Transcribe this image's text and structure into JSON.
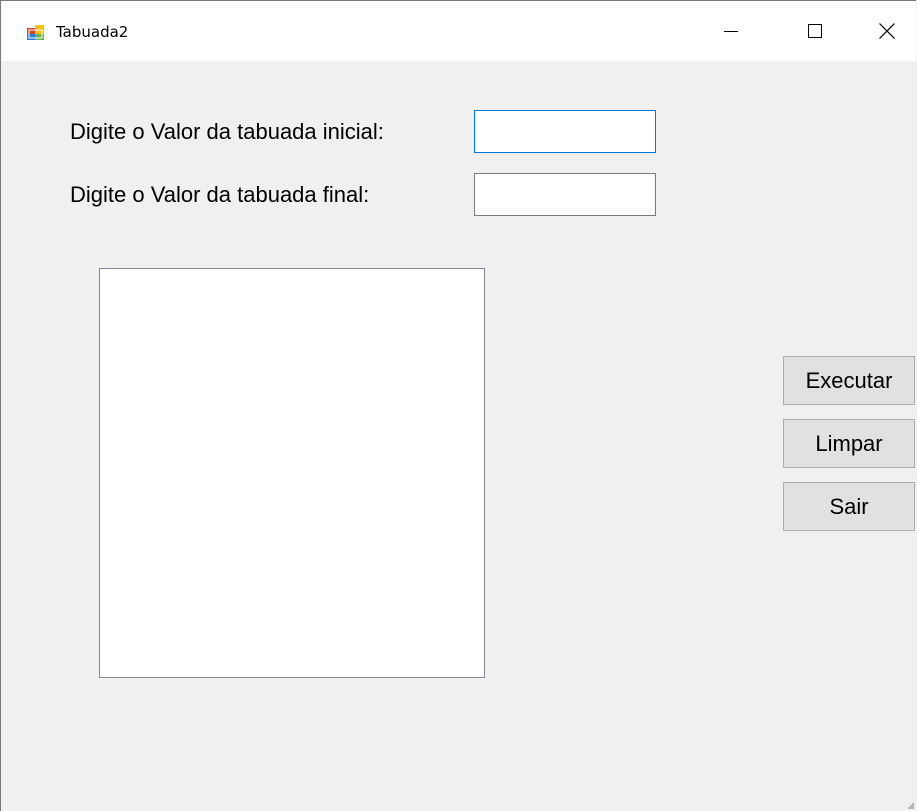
{
  "window": {
    "title": "Tabuada2",
    "controls": {
      "minimize": "minimize-icon",
      "maximize": "maximize-icon",
      "close": "close-icon"
    }
  },
  "form": {
    "label_initial": "Digite o Valor da tabuada inicial:",
    "label_final": "Digite o Valor da tabuada final:",
    "input_initial_value": "",
    "input_final_value": "",
    "list_items": []
  },
  "buttons": {
    "executar": "Executar",
    "limpar": "Limpar",
    "sair": "Sair"
  },
  "colors": {
    "focus_border": "#0078d7",
    "button_face": "#e1e1e1",
    "background": "#f0f0f0"
  }
}
